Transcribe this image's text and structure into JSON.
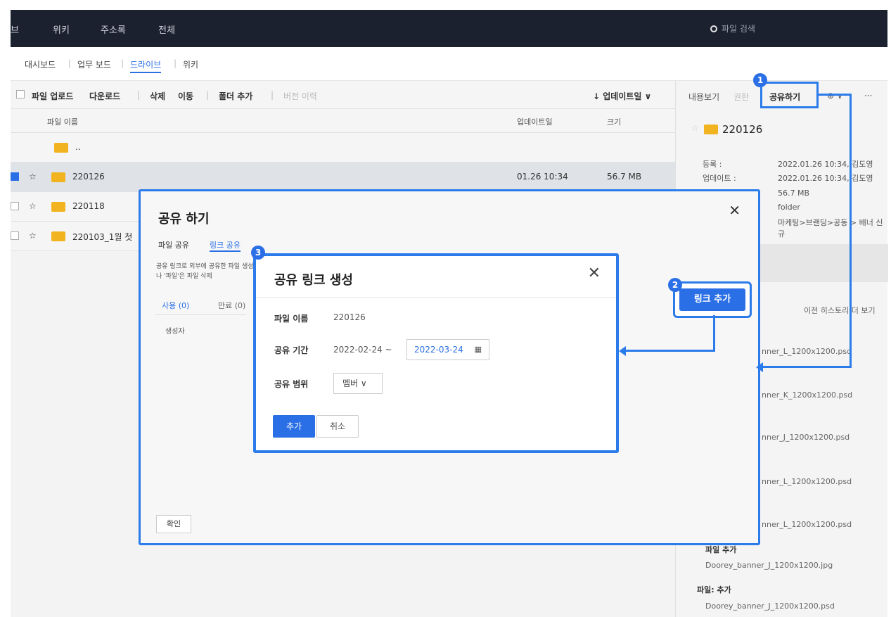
{
  "topbar": {
    "nav": [
      "브",
      "위키",
      "주소록",
      "전체"
    ],
    "search_placeholder": "파일 검색"
  },
  "subnav": {
    "items": [
      "대시보드",
      "업무 보드",
      "드라이브",
      "위키"
    ]
  },
  "toolbar": {
    "upload": "파일 업로드",
    "download": "다운로드",
    "delete": "삭제",
    "move": "이동",
    "add_folder": "폴더 추가",
    "version": "버전 이력",
    "sort": "↓ 업데이트일 ∨"
  },
  "columns": {
    "name": "파일 이름",
    "updated": "업데이트일",
    "size": "크기"
  },
  "files": [
    {
      "name": "..",
      "updated": "",
      "size": ""
    },
    {
      "name": "220126",
      "updated": "01.26 10:34",
      "size": "56.7 MB"
    },
    {
      "name": "220118",
      "updated": "",
      "size": ""
    },
    {
      "name": "220103_1월 첫",
      "updated": "",
      "size": ""
    }
  ],
  "right_panel": {
    "tabs": [
      "내용보기",
      "권한",
      "공유하기",
      "⊕ ∨",
      "···"
    ],
    "folder_title": "220126",
    "info": [
      {
        "label": "등록 :",
        "value": "2022.01.26 10:34, 김도영"
      },
      {
        "label": "업데이트 :",
        "value": "2022.01.26 10:34, 김도영"
      },
      {
        "label": "",
        "value": "56.7 MB"
      },
      {
        "label": "",
        "value": "folder"
      },
      {
        "label": "",
        "value": "마케팅>브랜딩>공동 > 배너 신규"
      }
    ],
    "history_link": "이전 히스토리 더 보기",
    "history": [
      "nner_L_1200x1200.psd",
      "nner_K_1200x1200.psd",
      "nner_J_1200x1200.psd",
      "nner_L_1200x1200.psd",
      "nner_L_1200x1200.psd",
      "파일 추가",
      "Doorey_banner_J_1200x1200.jpg",
      "파일: 추가",
      "Doorey_banner_J_1200x1200.psd"
    ]
  },
  "share_dialog": {
    "title": "공유 하기",
    "tabs": [
      "파일 공유",
      "링크 공유"
    ],
    "desc": "공유 링크로 외부에 공유한 파일 생성자 나 '파일'은 파일 삭제",
    "subtabs": [
      "사용 (0)",
      "만료 (0)"
    ],
    "col_creator": "생성자",
    "confirm": "확인",
    "add_link": "링크 추가"
  },
  "link_modal": {
    "title": "공유 링크 생성",
    "file_name_label": "파일 이름",
    "file_name_value": "220126",
    "period_label": "공유 기간",
    "period_start": "2022-02-24 ~",
    "period_end": "2022-03-24",
    "scope_label": "공유 범위",
    "scope_value": "멤버 ∨",
    "add": "추가",
    "cancel": "취소"
  },
  "badges": [
    "1",
    "2",
    "3"
  ],
  "colors": {
    "accent": "#2b6fe6",
    "highlight": "#2b7bea",
    "folder": "#f2b320",
    "topbar": "#1c2130"
  }
}
